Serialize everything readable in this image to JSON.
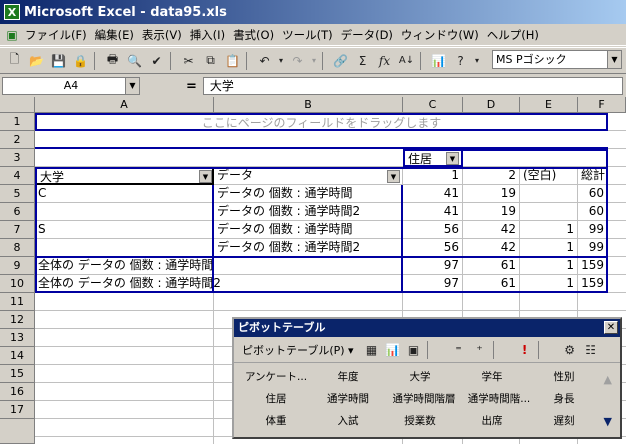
{
  "window": {
    "title": "Microsoft Excel - data95.xls"
  },
  "menu": [
    "ファイル(F)",
    "編集(E)",
    "表示(V)",
    "挿入(I)",
    "書式(O)",
    "ツール(T)",
    "データ(D)",
    "ウィンドウ(W)",
    "ヘルプ(H)"
  ],
  "toolbar": {
    "font_name": "MS Pゴシック"
  },
  "formula_bar": {
    "cell_ref": "A4",
    "equals": "=",
    "content": "大学"
  },
  "columns": [
    "A",
    "B",
    "C",
    "D",
    "E",
    "F"
  ],
  "rows": [
    "1",
    "2",
    "3",
    "4",
    "5",
    "6",
    "7",
    "8",
    "9",
    "10",
    "11",
    "12",
    "13",
    "14",
    "15",
    "16",
    "17"
  ],
  "sheet": {
    "r1_hint": "ここにページのフィールドをドラッグします",
    "r3_col_field": "住居",
    "r4": {
      "a": "大学",
      "b": "データ",
      "c": "1",
      "d": "2",
      "e": "(空白)",
      "f": "総計"
    },
    "r5": {
      "a": "C",
      "b": "データの 個数 : 通学時間",
      "c": "41",
      "d": "19",
      "e": "",
      "f": "60"
    },
    "r6": {
      "b": "データの 個数 : 通学時間2",
      "c": "41",
      "d": "19",
      "e": "",
      "f": "60"
    },
    "r7": {
      "a": "S",
      "b": "データの 個数 : 通学時間",
      "c": "56",
      "d": "42",
      "e": "1",
      "f": "99"
    },
    "r8": {
      "b": "データの 個数 : 通学時間2",
      "c": "56",
      "d": "42",
      "e": "1",
      "f": "99"
    },
    "r9": {
      "a": "全体の データの 個数 : 通学時間",
      "c": "97",
      "d": "61",
      "e": "1",
      "f": "159"
    },
    "r10": {
      "a": "全体の データの 個数 : 通学時間2",
      "c": "97",
      "d": "61",
      "e": "1",
      "f": "159"
    }
  },
  "pivot_toolbar": {
    "title": "ピボットテーブル",
    "menu_label": "ピボットテーブル(P)",
    "fields": [
      "アンケート...",
      "年度",
      "大学",
      "学年",
      "性別",
      "住居",
      "通学時間",
      "通学時間階層",
      "通学時間階...",
      "身長",
      "体重",
      "入試",
      "授業数",
      "出席",
      "遅刻"
    ]
  }
}
